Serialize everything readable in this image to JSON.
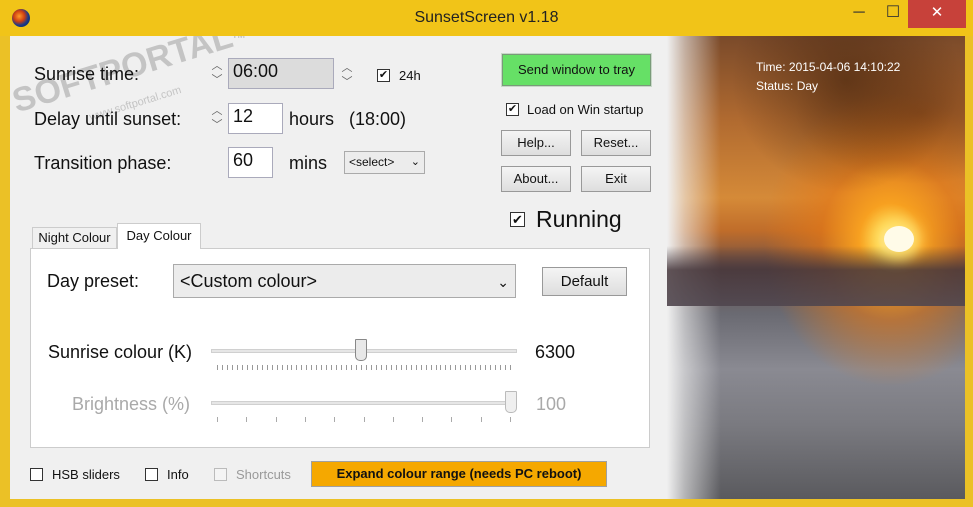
{
  "window": {
    "title": "SunsetScreen v1.18",
    "minimize_glyph": "─",
    "maximize_glyph": "☐",
    "close_glyph": "✕"
  },
  "watermark": {
    "brand": "SOFTPORTAL",
    "tm": "TM",
    "url": "www.softportal.com"
  },
  "settings": {
    "sunrise_label": "Sunrise time:",
    "sunrise_value": "06:00",
    "format_24h_label": "24h",
    "format_24h_checked": true,
    "delay_label": "Delay until sunset:",
    "delay_value": "12",
    "delay_unit": "hours",
    "delay_result": "(18:00)",
    "transition_label": "Transition phase:",
    "transition_value": "60",
    "transition_unit": "mins",
    "transition_select": "<select>"
  },
  "actions": {
    "send_to_tray": "Send window to tray",
    "load_on_startup": "Load on Win startup",
    "load_on_startup_checked": true,
    "help": "Help...",
    "reset": "Reset...",
    "about": "About...",
    "exit": "Exit",
    "running": "Running",
    "running_checked": true
  },
  "status": {
    "time": "Time: 2015-04-06 14:10:22",
    "status": "Status: Day"
  },
  "tabs": {
    "night": "Night Colour",
    "day": "Day Colour",
    "active": "day"
  },
  "day_panel": {
    "preset_label": "Day preset:",
    "preset_value": "<Custom colour>",
    "default_button": "Default",
    "sunrise_colour_label": "Sunrise colour (K)",
    "sunrise_colour_value": "6300",
    "sunrise_colour_fraction": 0.49,
    "brightness_label": "Brightness (%)",
    "brightness_value": "100",
    "brightness_fraction": 1.0
  },
  "footer": {
    "hsb_sliders": "HSB sliders",
    "hsb_checked": false,
    "info": "Info",
    "info_checked": false,
    "shortcuts": "Shortcuts",
    "shortcuts_checked": false,
    "expand_range": "Expand colour range (needs PC reboot)"
  },
  "colors": {
    "title_bar": "#f1c418",
    "close_button": "#c7413a",
    "send_tray_button": "#66e066",
    "expand_button": "#f5a800"
  }
}
